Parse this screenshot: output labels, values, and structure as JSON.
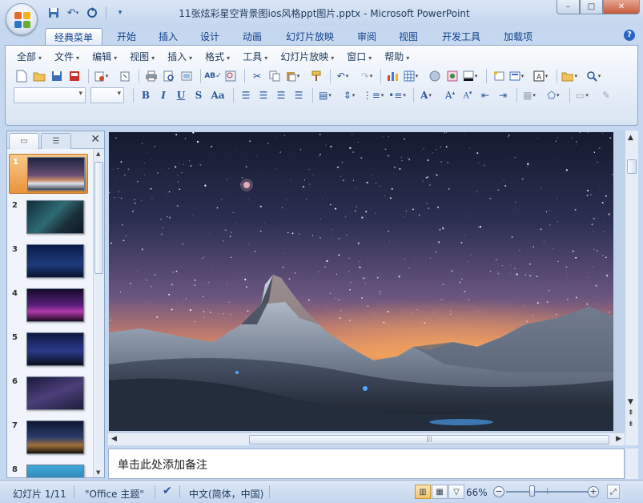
{
  "window": {
    "title": "11张炫彩星空背景图ios风格ppt图片.pptx - Microsoft PowerPoint",
    "minimize": "–",
    "maximize": "□",
    "close": "✕"
  },
  "ribbon_tabs": [
    "经典菜单",
    "开始",
    "插入",
    "设计",
    "动画",
    "幻灯片放映",
    "审阅",
    "视图",
    "开发工具",
    "加载项"
  ],
  "active_tab": "经典菜单",
  "menus": [
    "全部",
    "文件",
    "编辑",
    "视图",
    "插入",
    "格式",
    "工具",
    "幻灯片放映",
    "窗口",
    "帮助"
  ],
  "format_buttons": {
    "bold": "B",
    "italic": "I",
    "underline": "U",
    "shadow": "S",
    "case": "Aa"
  },
  "slides": [
    {
      "number": "1"
    },
    {
      "number": "2"
    },
    {
      "number": "3"
    },
    {
      "number": "4"
    },
    {
      "number": "5"
    },
    {
      "number": "6"
    },
    {
      "number": "7"
    },
    {
      "number": "8"
    }
  ],
  "selected_slide": 1,
  "notes_placeholder": "单击此处添加备注",
  "status": {
    "slide_indicator": "幻灯片 1/11",
    "theme": "\"Office 主题\"",
    "language": "中文(简体，中国)",
    "zoom": "66%"
  },
  "colors": {
    "accent": "#c5d8ef",
    "selected_thumb": "#e8943d"
  }
}
